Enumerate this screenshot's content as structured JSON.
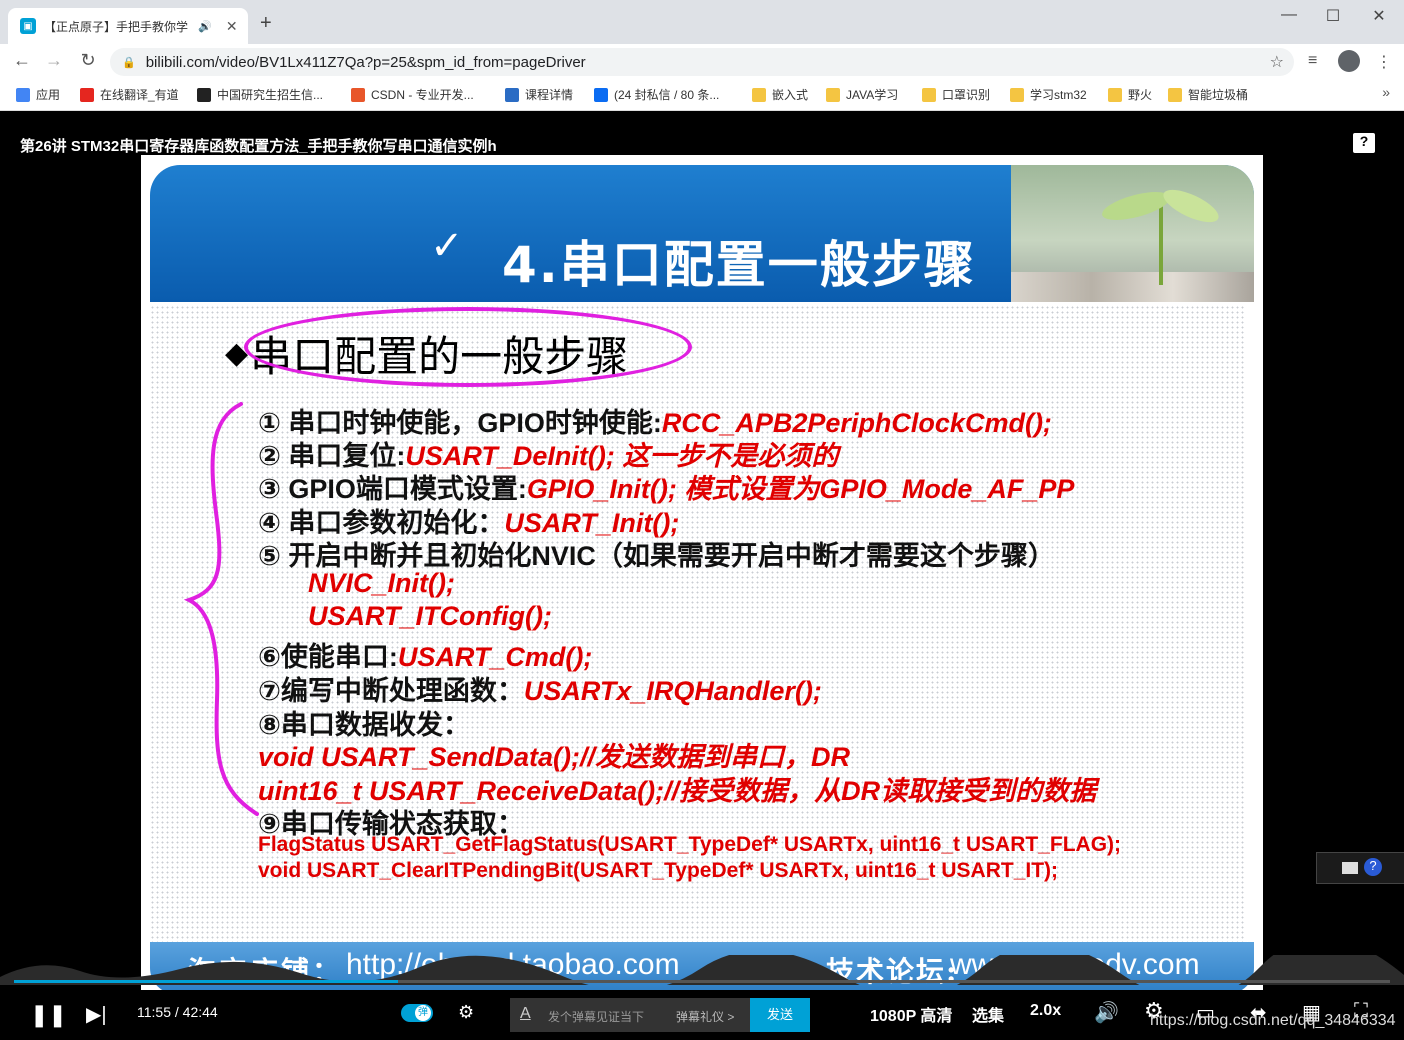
{
  "browser": {
    "tab_title": "【正点原子】手把手教你学",
    "tab_audio": "🔊",
    "tab_close": "✕",
    "new_tab": "+",
    "url": "bilibili.com/video/BV1Lx411Z7Qa?p=25&spm_id_from=pageDriver",
    "bookmarks": [
      {
        "label": "应用",
        "color": "#4285f4"
      },
      {
        "label": "在线翻译_有道",
        "color": "#e5261f"
      },
      {
        "label": "中国研究生招生信...",
        "color": "#222"
      },
      {
        "label": "CSDN - 专业开发...",
        "color": "#e8562a"
      },
      {
        "label": "课程详情",
        "color": "#2b6cc4"
      },
      {
        "label": "(24 封私信 / 80 条...",
        "color": "#0b6cf2"
      },
      {
        "label": "嵌入式",
        "color": "#f4c542"
      },
      {
        "label": "JAVA学习",
        "color": "#f4c542"
      },
      {
        "label": "口罩识别",
        "color": "#f4c542"
      },
      {
        "label": "学习stm32",
        "color": "#f4c542"
      },
      {
        "label": "野火",
        "color": "#f4c542"
      },
      {
        "label": "智能垃圾桶",
        "color": "#f4c542"
      }
    ],
    "bookmarks_more": "»"
  },
  "video": {
    "title": "第26讲 STM32串口寄存器库函数配置方法_手把手教你写串口通信实例h",
    "help": "?",
    "current_time": "11:55",
    "time_sep": "/",
    "duration": "42:44",
    "progress_fraction": 0.279,
    "danmu_toggle_label": "弹",
    "danmu_placeholder": "发个弹幕见证当下",
    "danmu_etiquette": "弹幕礼仪 >",
    "send_label": "发送",
    "quality": "1080P 高清",
    "episodes": "选集",
    "speed": "2.0x",
    "watermark": "https://blog.csdn.net/qq_34846334"
  },
  "slide": {
    "banner_check": "✓",
    "banner_title": "4.串口配置一般步骤",
    "heading_bullet": "◆",
    "heading": "串口配置的一般步骤",
    "lines": [
      {
        "a": "① 串口时钟使能，GPIO时钟使能:",
        "b": "RCC_APB2PeriphClockCmd();"
      },
      {
        "a": "② 串口复位:",
        "b": "USART_DeInit(); 这一步不是必须的"
      },
      {
        "a": "③ GPIO端口模式设置:",
        "b": "GPIO_Init(); 模式设置为GPIO_Mode_AF_PP"
      },
      {
        "a": "④ 串口参数初始化：",
        "b": "USART_Init();"
      },
      {
        "a": "⑤ 开启中断并且初始化NVIC（如果需要开启中断才需要这个步骤）",
        "b": ""
      },
      {
        "a": "",
        "b": "NVIC_Init();"
      },
      {
        "a": "",
        "b": "USART_ITConfig();"
      },
      {
        "a": "⑥使能串口:",
        "b": "USART_Cmd();"
      },
      {
        "a": "⑦编写中断处理函数：",
        "b": "USART­x_IRQHandler();"
      },
      {
        "a": "⑧串口数据收发：",
        "b": ""
      },
      {
        "a": "",
        "b": "void USART_SendData();//发送数据到串口，DR"
      },
      {
        "a": "",
        "b": "uint16_t USART_ReceiveData();//接受数据，从DR读取接受到的数据"
      },
      {
        "a": "⑨串口传输状态获取：",
        "b": ""
      }
    ],
    "code1": "FlagStatus USART_GetFlagStatus(USART_TypeDef* USARTx, uint16_t USART_FLAG);",
    "code2": "void USART_ClearITPendingBit(USART_TypeDef* USARTx, uint16_t USART_IT);",
    "footer_shop": "淘宝店铺：",
    "footer_shop_url": "http://eboard.taobao.com",
    "footer_forum": "技术论坛:",
    "footer_forum_url": "www.openedv.com"
  }
}
